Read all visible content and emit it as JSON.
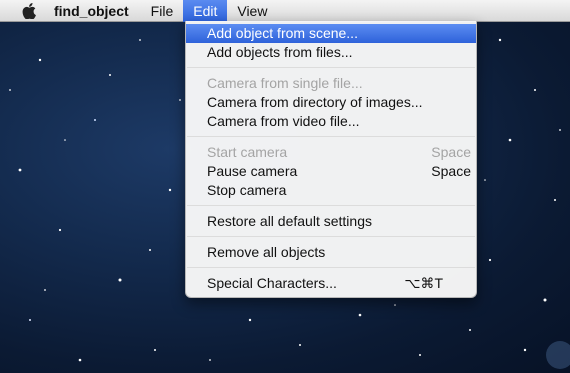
{
  "menubar": {
    "apple_icon": "apple-icon",
    "app_name": "find_object",
    "menus": [
      "File",
      "Edit",
      "View"
    ],
    "active_menu": "Edit"
  },
  "edit_menu": {
    "items": [
      {
        "label": "Add object from scene...",
        "shortcut": "",
        "state": "highlighted"
      },
      {
        "label": "Add objects from files...",
        "shortcut": "",
        "state": "enabled"
      },
      {
        "label": "Camera from single file...",
        "shortcut": "",
        "state": "disabled"
      },
      {
        "label": "Camera from directory of images...",
        "shortcut": "",
        "state": "enabled"
      },
      {
        "label": "Camera from video file...",
        "shortcut": "",
        "state": "enabled"
      },
      {
        "label": "Start camera",
        "shortcut": "Space",
        "state": "disabled"
      },
      {
        "label": "Pause camera",
        "shortcut": "Space",
        "state": "enabled"
      },
      {
        "label": "Stop camera",
        "shortcut": "",
        "state": "enabled"
      },
      {
        "label": "Restore all default settings",
        "shortcut": "",
        "state": "enabled"
      },
      {
        "label": "Remove all objects",
        "shortcut": "",
        "state": "enabled"
      },
      {
        "label": "Special Characters...",
        "shortcut": "⌥⌘T",
        "state": "enabled"
      }
    ]
  },
  "colors": {
    "highlight": "#2e62da",
    "disabled_text": "#a4a4a4",
    "background": "#132a4d"
  }
}
